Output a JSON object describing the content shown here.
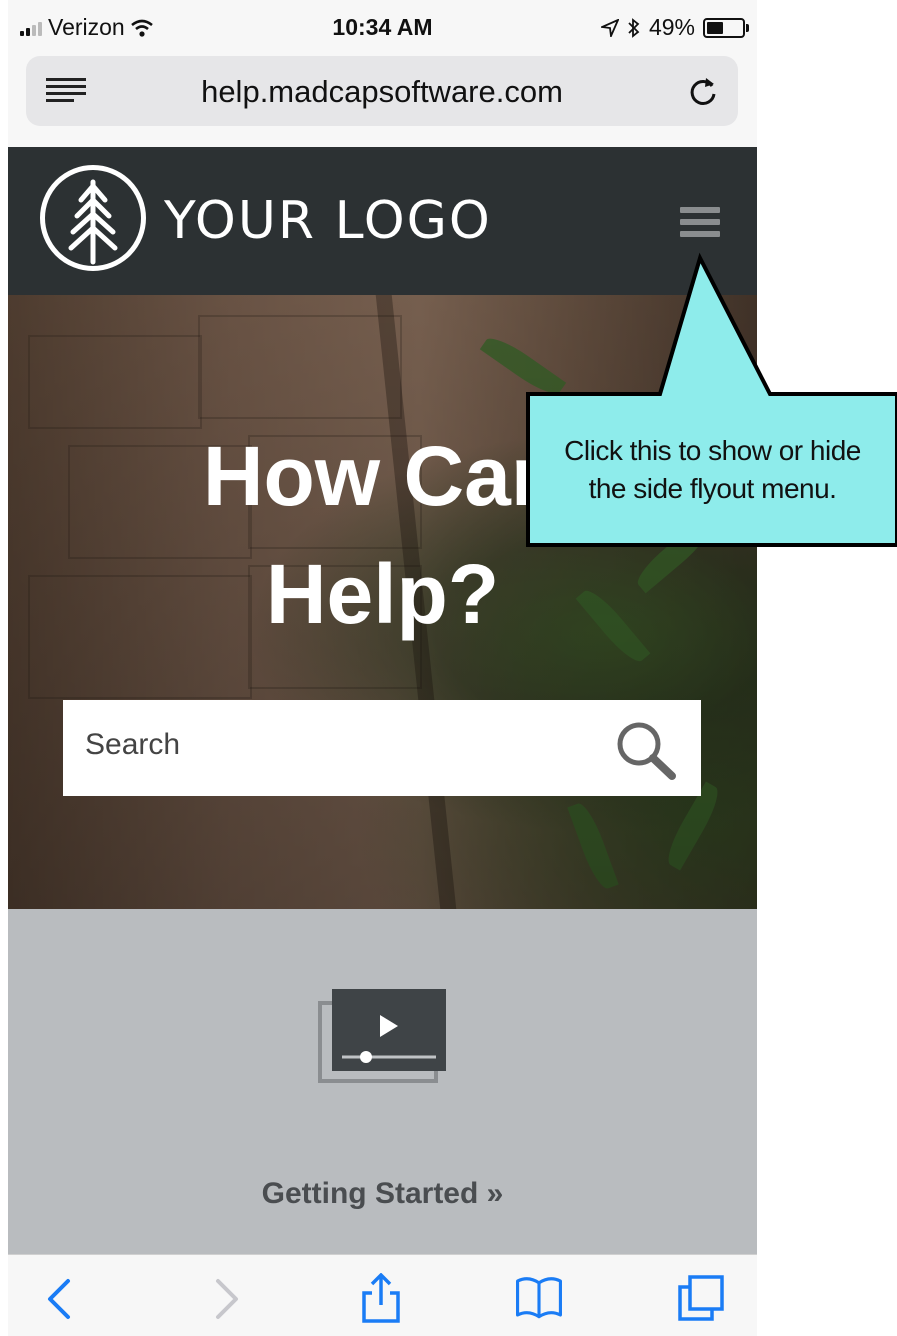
{
  "status_bar": {
    "carrier": "Verizon",
    "time": "10:34 AM",
    "battery": "49%"
  },
  "browser": {
    "url": "help.madcapsoftware.com"
  },
  "header": {
    "logo_text": "YOUR LOGO"
  },
  "hero": {
    "title_line1": "How Can",
    "title_line2": "Help?",
    "search_placeholder": "Search"
  },
  "section": {
    "link_label": "Getting Started »"
  },
  "callout": {
    "line1": "Click this to show or hide",
    "line2": "the side flyout menu.",
    "color": "#8eeceb"
  },
  "colors": {
    "header_bg": "#2c3133",
    "section_bg": "#b9bcbf",
    "ios_blue": "#1a7cf5"
  }
}
